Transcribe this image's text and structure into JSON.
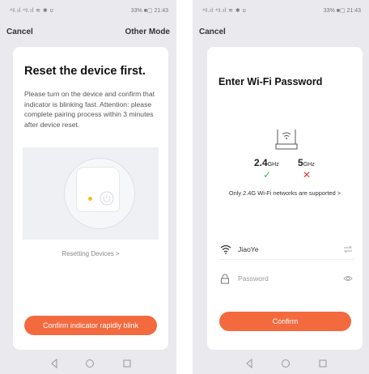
{
  "left": {
    "status": {
      "signal": "⁴ᵍ.ıl ⁴ᵍ.ıl ≋ ✱ ʊ",
      "battery": "33% ■▢ 21:43"
    },
    "topbar": {
      "cancel": "Cancel",
      "other_mode": "Other Mode"
    },
    "title": "Reset the device first.",
    "description": "Please turn on the device and confirm that indicator is blinking fast. Attention: please complete pairing process within 3 minutes after device reset.",
    "link": "Resetting Devices >",
    "button": "Confirm indicator rapidly blink"
  },
  "right": {
    "status": {
      "signal": "⁴ᵍ.ıl ⁴ᵍ.ıl ≋ ✱ ʊ",
      "battery": "33% ■▢ 21:43"
    },
    "topbar": {
      "cancel": "Cancel"
    },
    "title": "Enter Wi-Fi Password",
    "freq_24": "2.4",
    "freq_24_unit": "GHz",
    "freq_5": "5",
    "freq_5_unit": "GHz",
    "check": "✓",
    "cross": "✕",
    "note": "Only 2.4G Wi-Fi networks are supported >",
    "ssid": "JiaoYe",
    "password_placeholder": "Password",
    "button": "Confirm"
  },
  "colors": {
    "accent": "#f36a3f",
    "ok": "#3cb45a",
    "bad": "#e5393a",
    "background": "#e9e9ee"
  },
  "icons": [
    "wifi-icon",
    "lock-icon",
    "eye-icon",
    "swap-icon",
    "router-icon",
    "power-icon",
    "back-icon",
    "home-icon",
    "recents-icon"
  ]
}
